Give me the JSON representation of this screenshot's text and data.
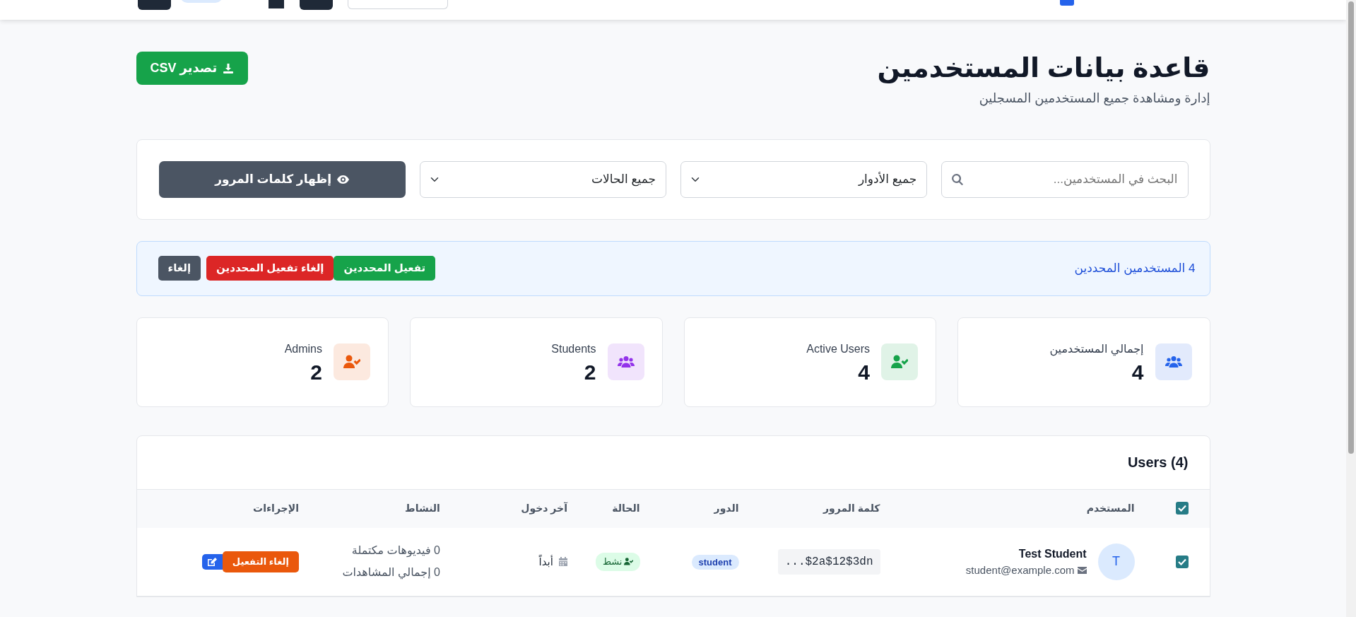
{
  "header": {
    "title": "قاعدة بيانات المستخدمين",
    "subtitle": "إدارة ومشاهدة جميع المستخدمين المسجلين",
    "export_button": "تصدير CSV"
  },
  "filters": {
    "search": {
      "placeholder": "البحث في المستخدمين..."
    },
    "role_select": "جميع الأدوار",
    "status_select": "جميع الحالات",
    "show_passwords_button": "إظهار كلمات المرور"
  },
  "bulk_bar": {
    "count_text": "4 المستخدمين المحددين",
    "buttons": [
      {
        "label": "تفعيل المحددين",
        "kind": "activate"
      },
      {
        "label": "إلغاء تفعيل المحددين",
        "kind": "deactivate"
      },
      {
        "label": "إلغاء",
        "kind": "cancel"
      }
    ]
  },
  "stats": [
    {
      "label": "إجمالي المستخدمين",
      "value": "4",
      "kind": "group",
      "color": "#2563eb"
    },
    {
      "label": "Active Users",
      "value": "4",
      "kind": "check",
      "color": "#16a34a"
    },
    {
      "label": "Students",
      "value": "2",
      "kind": "group",
      "color": "#9333ea"
    },
    {
      "label": "Admins",
      "value": "2",
      "kind": "check",
      "color": "#ea580c"
    }
  ],
  "table": {
    "title": "Users (4)",
    "select_all": {
      "checked": true
    },
    "columns": [
      "المستخدم",
      "كلمة المرور",
      "الدور",
      "الحالة",
      "آخر دخول",
      "النشاط",
      "الإجراءات"
    ],
    "rows": [
      {
        "checked": true,
        "avatar": "T",
        "name": "Test Student",
        "email": "student@example.com",
        "password": "...$2a$12$3dn",
        "role": "student",
        "status": "نشط",
        "active": true,
        "last_login": "أبداً",
        "activity": [
          "0 فيديوهات مكتملة",
          "0 إجمالي المشاهدات"
        ],
        "action": "إلغاء التفعيل"
      }
    ]
  }
}
